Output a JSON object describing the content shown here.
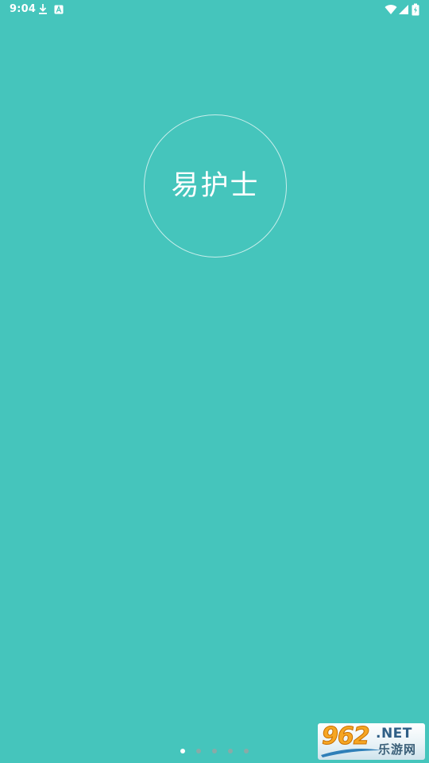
{
  "status_bar": {
    "time": "9:04",
    "icons": [
      "download-icon",
      "a-icon",
      "wifi-icon",
      "signal-icon",
      "battery-icon"
    ]
  },
  "splash": {
    "app_name": "易护士"
  },
  "page_indicator": {
    "total": 5,
    "active_index": 0
  },
  "watermark": {
    "number": "962",
    "suffix": ".NET",
    "subtitle": "乐游网"
  },
  "colors": {
    "background": "#45c5bc",
    "text": "#ffffff",
    "dot_inactive": "#a0a0a0",
    "dot_active": "#ffffff",
    "watermark_orange": "#f6a623",
    "watermark_blue": "#2f5f86"
  }
}
